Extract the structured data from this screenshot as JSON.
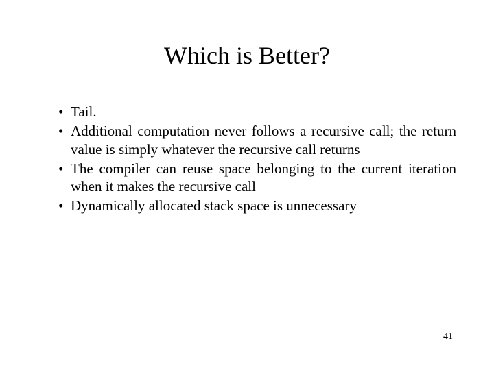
{
  "slide": {
    "title": "Which is Better?",
    "bullets": [
      "Tail.",
      "Additional computation never follows a recursive call; the return value is simply whatever the recursive call returns",
      "The compiler can reuse space belonging to the current iteration when it makes the recursive call",
      "Dynamically allocated stack space is unnecessary"
    ],
    "page_number": "41"
  }
}
